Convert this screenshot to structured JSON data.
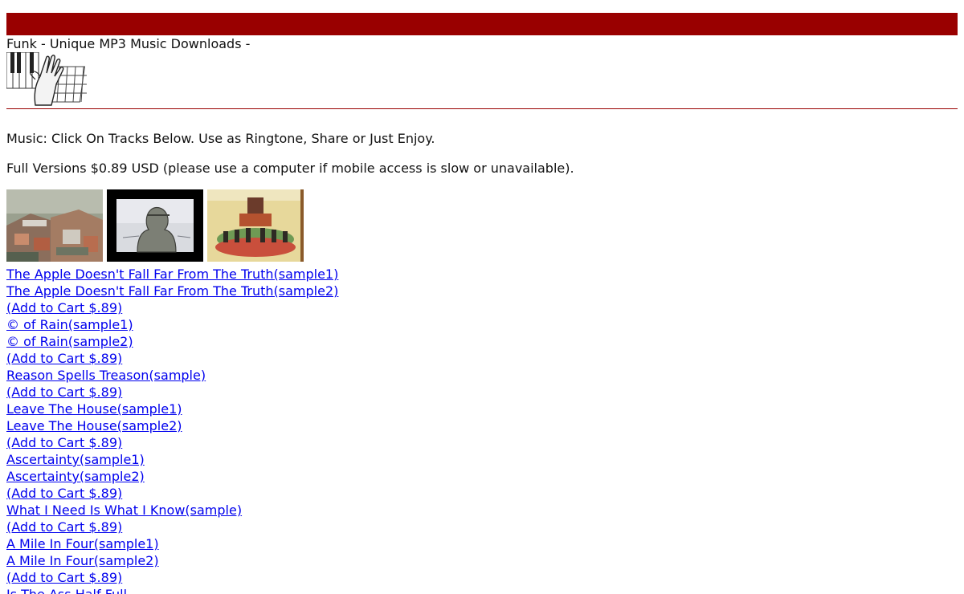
{
  "site": {
    "title": "Funk - Unique MP3 Music Downloads -",
    "accent_color": "#990000",
    "link_color": "#0000ee"
  },
  "intro": "Music: Click On Tracks Below. Use as Ringtone, Share or Just Enjoy.",
  "pricing": "Full Versions $0.89 USD (please use a computer if mobile access is slow or unavailable).",
  "albums": [
    {
      "name": "album-cover-city-rooftops"
    },
    {
      "name": "album-cover-sketch-figure"
    },
    {
      "name": "album-cover-painted-crowd"
    }
  ],
  "tracks": [
    "The Apple Doesn't Fall Far From The Truth(sample1)",
    "The Apple Doesn't Fall Far From The Truth(sample2)",
    "(Add to Cart $.89)",
    "© of Rain(sample1)",
    "© of Rain(sample2)",
    "(Add to Cart $.89)",
    "Reason Spells Treason(sample)",
    "(Add to Cart $.89)",
    "Leave The House(sample1)",
    "Leave The House(sample2)",
    "(Add to Cart $.89)",
    "Ascertainty(sample1)",
    "Ascertainty(sample2)",
    "(Add to Cart $.89)",
    "What I Need Is What I Know(sample)",
    "(Add to Cart $.89)",
    "A Mile In Four(sample1)",
    "A Mile In Four(sample2)",
    "(Add to Cart $.89)",
    "Is The Ass Half Full"
  ]
}
